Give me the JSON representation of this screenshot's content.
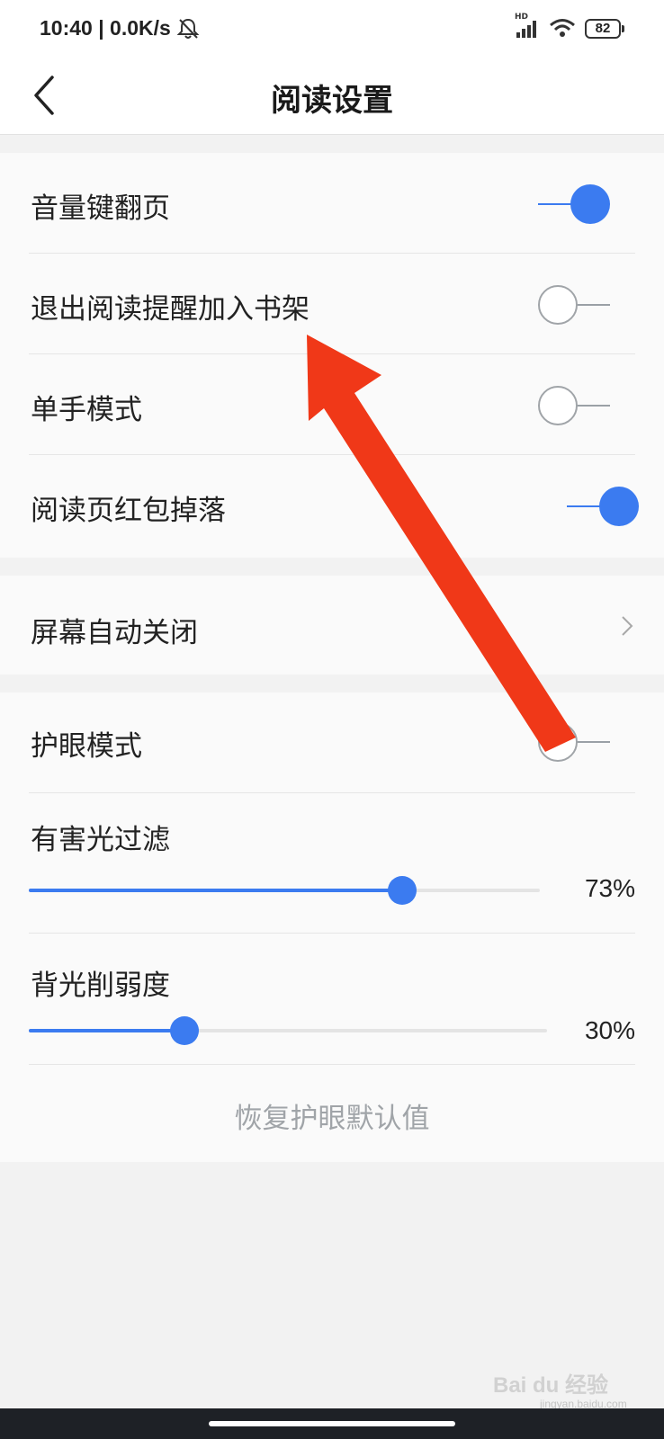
{
  "status_bar": {
    "time": "10:40 | 0.0K/s",
    "network_type": "HD",
    "battery": "82",
    "icons": [
      "bell-off-icon",
      "signal-icon",
      "wifi-icon",
      "battery-icon"
    ]
  },
  "header": {
    "title": "阅读设置",
    "back_icon": "chevron-left-icon"
  },
  "group1": {
    "items": [
      {
        "label": "音量键翻页",
        "enabled": true
      },
      {
        "label": "退出阅读提醒加入书架",
        "enabled": false
      },
      {
        "label": "单手模式",
        "enabled": false
      },
      {
        "label": "阅读页红包掉落",
        "enabled": true
      }
    ]
  },
  "group2": {
    "item": {
      "label": "屏幕自动关闭",
      "icon": "chevron-right-icon"
    }
  },
  "group3": {
    "eye_mode": {
      "label": "护眼模式",
      "enabled": false
    },
    "blue_filter": {
      "label": "有害光过滤",
      "value_text": "73%",
      "value": 0.73
    },
    "backlight": {
      "label": "背光削弱度",
      "value_text": "30%",
      "value": 0.3
    },
    "reset_label": "恢复护眼默认值"
  },
  "colors": {
    "accent": "#3b7bf0",
    "annotation_arrow": "#f03818",
    "background": "#f2f2f2",
    "card": "#fafafa"
  },
  "watermark": {
    "brand": "Bai du 经验",
    "site": "jingyan.baidu.com"
  }
}
